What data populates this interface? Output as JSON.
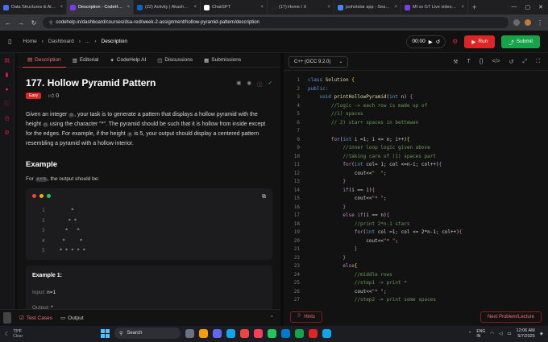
{
  "browser": {
    "tabs": [
      {
        "label": "Data Structures & Al…",
        "color": "#4a6cf7",
        "active": false
      },
      {
        "label": "Description - CodeH…",
        "color": "#7c3aed",
        "active": true
      },
      {
        "label": "(22) Activity | Akash…",
        "color": "#0a66c2",
        "active": false
      },
      {
        "label": "ChatGPT",
        "color": "#ffffff",
        "active": false
      },
      {
        "label": "(17) Home / X",
        "color": "#222222",
        "active": false
      },
      {
        "label": "jsohotstar app - Sea…",
        "color": "#4285f4",
        "active": false
      },
      {
        "label": "MI vs GT Live video…",
        "color": "#7b3fe4",
        "active": false
      }
    ],
    "new_tab": "+",
    "url": "codehelp.in/dashboard/courses/dsa-red/week-2-assignment/hollow-pyramid-pattern/description"
  },
  "header": {
    "crumbs": [
      "Home",
      "Dashboard",
      "...",
      "Description"
    ],
    "timer": "00:00",
    "run_label": "Run",
    "submit_label": "Submit"
  },
  "left_tabs": [
    "Description",
    "Editorial",
    "CodeHelp AI",
    "Discussions",
    "Submissions"
  ],
  "problem": {
    "title": "177. Hollow Pyramid Pattern",
    "difficulty": "Easy",
    "likes": "0",
    "desc_parts": {
      "p1": "Given an integer ",
      "chip1": "n",
      "p2": ", your task is to generate a pattern that displays a hollow pyramid with the height ",
      "chip2": "n",
      "p3": " using the character \"*\". The pyramid should be such that it is hollow from inside except for the edges. For example, if the height ",
      "chip3": "n",
      "p4": " is 5, your output should display a centered pattern resembling a pyramid with a hollow interior."
    },
    "example_heading": "Example",
    "example_line_pre": "For ",
    "example_chip": "n = 5",
    "example_line_post": ", the output should be:",
    "pattern": [
      {
        "num": "1",
        "text": "    *"
      },
      {
        "num": "2",
        "text": "   * *"
      },
      {
        "num": "3",
        "text": "  *   *"
      },
      {
        "num": "4",
        "text": " *     *"
      },
      {
        "num": "5",
        "text": "* * * * *"
      }
    ],
    "example1_title": "Example 1:",
    "example1_input_label": "Input:",
    "example1_input_value": "n=1",
    "example1_output_label": "Output:",
    "example1_output_value": "*"
  },
  "bottom_left": {
    "testcases": "Test Cases",
    "output": "Output"
  },
  "editor": {
    "language": "C++ (GCC 9.2.0)",
    "lines": [
      {
        "n": "1",
        "segs": [
          {
            "c": "kw",
            "t": "class "
          },
          {
            "c": "fn",
            "t": "Solution "
          },
          {
            "c": "br",
            "t": "{"
          }
        ]
      },
      {
        "n": "2",
        "segs": [
          {
            "c": "kw",
            "t": "public:"
          }
        ]
      },
      {
        "n": "3",
        "segs": [
          {
            "c": "",
            "t": "    "
          },
          {
            "c": "kw",
            "t": "void "
          },
          {
            "c": "fn",
            "t": "printHollowPyramid"
          },
          {
            "c": "",
            "t": "("
          },
          {
            "c": "kw",
            "t": "int "
          },
          {
            "c": "",
            "t": "n) "
          },
          {
            "c": "k",
            "t": "{"
          }
        ]
      },
      {
        "n": "4",
        "segs": [
          {
            "c": "cm",
            "t": "        //logic -> each row is made up of"
          }
        ]
      },
      {
        "n": "5",
        "segs": [
          {
            "c": "cm",
            "t": "        //1) spaces"
          }
        ]
      },
      {
        "n": "6",
        "segs": [
          {
            "c": "cm",
            "t": "        // 2) star+ spaces in bettewen"
          }
        ]
      },
      {
        "n": "7",
        "segs": [
          {
            "c": "",
            "t": ""
          }
        ]
      },
      {
        "n": "8",
        "segs": [
          {
            "c": "",
            "t": "        "
          },
          {
            "c": "k",
            "t": "for"
          },
          {
            "c": "",
            "t": "("
          },
          {
            "c": "kw",
            "t": "int "
          },
          {
            "c": "",
            "t": "i =1; i <= n; i++)"
          },
          {
            "c": "br",
            "t": "{"
          }
        ]
      },
      {
        "n": "9",
        "segs": [
          {
            "c": "cm",
            "t": "            //inner loop logic given above"
          }
        ]
      },
      {
        "n": "10",
        "segs": [
          {
            "c": "cm",
            "t": "            //taking care of (1) spaces part"
          }
        ]
      },
      {
        "n": "11",
        "segs": [
          {
            "c": "",
            "t": "            "
          },
          {
            "c": "k",
            "t": "for"
          },
          {
            "c": "",
            "t": "("
          },
          {
            "c": "kw",
            "t": "int "
          },
          {
            "c": "",
            "t": "col= 1; col <=n-i; col++)"
          },
          {
            "c": "k",
            "t": "{"
          }
        ]
      },
      {
        "n": "12",
        "segs": [
          {
            "c": "",
            "t": "                cout<<"
          },
          {
            "c": "str",
            "t": "\"  \""
          },
          {
            "c": "",
            "t": ";"
          }
        ]
      },
      {
        "n": "13",
        "segs": [
          {
            "c": "",
            "t": "            "
          },
          {
            "c": "k",
            "t": "}"
          }
        ]
      },
      {
        "n": "14",
        "segs": [
          {
            "c": "",
            "t": "            "
          },
          {
            "c": "k",
            "t": "if"
          },
          {
            "c": "",
            "t": "(i == "
          },
          {
            "c": "nm",
            "t": "1"
          },
          {
            "c": "",
            "t": ")"
          },
          {
            "c": "k",
            "t": "{"
          }
        ]
      },
      {
        "n": "15",
        "segs": [
          {
            "c": "",
            "t": "                cout<<"
          },
          {
            "c": "str",
            "t": "\"* \""
          },
          {
            "c": "",
            "t": ";"
          }
        ]
      },
      {
        "n": "16",
        "segs": [
          {
            "c": "",
            "t": "            "
          },
          {
            "c": "k",
            "t": "}"
          }
        ]
      },
      {
        "n": "17",
        "segs": [
          {
            "c": "",
            "t": "            "
          },
          {
            "c": "k",
            "t": "else if"
          },
          {
            "c": "",
            "t": "(i == n)"
          },
          {
            "c": "k",
            "t": "{"
          }
        ]
      },
      {
        "n": "18",
        "segs": [
          {
            "c": "cm",
            "t": "                //print 2*n-1 stars"
          }
        ]
      },
      {
        "n": "19",
        "segs": [
          {
            "c": "",
            "t": "                "
          },
          {
            "c": "k",
            "t": "for"
          },
          {
            "c": "",
            "t": "("
          },
          {
            "c": "kw",
            "t": "int "
          },
          {
            "c": "",
            "t": "col =1; col <= 2*n-1; col++)"
          },
          {
            "c": "k",
            "t": "{"
          }
        ]
      },
      {
        "n": "20",
        "segs": [
          {
            "c": "",
            "t": "                    cout<<"
          },
          {
            "c": "str",
            "t": "\"* \""
          },
          {
            "c": "",
            "t": ";"
          }
        ]
      },
      {
        "n": "21",
        "segs": [
          {
            "c": "",
            "t": "                "
          },
          {
            "c": "k",
            "t": "}"
          }
        ]
      },
      {
        "n": "22",
        "segs": [
          {
            "c": "",
            "t": "            "
          },
          {
            "c": "k",
            "t": "}"
          }
        ]
      },
      {
        "n": "23",
        "segs": [
          {
            "c": "",
            "t": "            "
          },
          {
            "c": "k",
            "t": "else"
          },
          {
            "c": "br",
            "t": "{"
          }
        ]
      },
      {
        "n": "24",
        "segs": [
          {
            "c": "cm",
            "t": "                //middle rows"
          }
        ]
      },
      {
        "n": "25",
        "segs": [
          {
            "c": "cm",
            "t": "                //step1 -> print *"
          }
        ]
      },
      {
        "n": "26",
        "segs": [
          {
            "c": "",
            "t": "                cout<<"
          },
          {
            "c": "str",
            "t": "\"* \""
          },
          {
            "c": "",
            "t": ";"
          }
        ]
      },
      {
        "n": "27",
        "segs": [
          {
            "c": "cm",
            "t": "                //step2 -> print some spaces"
          }
        ]
      }
    ],
    "hints_label": "Hints",
    "next_label": "Next Problem/Lecture"
  },
  "taskbar": {
    "temp": "73°F",
    "weather": "Clear",
    "search": "Search",
    "lang": "ENG",
    "region": "IN",
    "time": "12:06 AM",
    "date": "5/7/2025"
  }
}
